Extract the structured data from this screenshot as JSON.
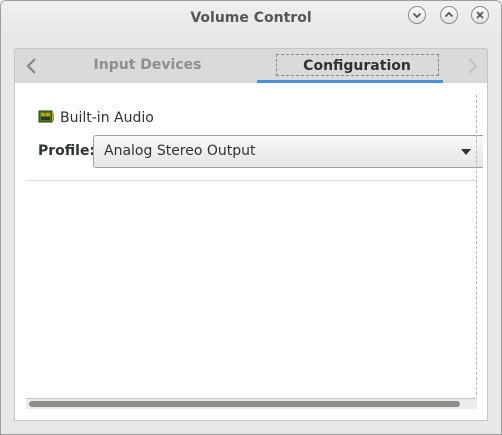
{
  "window": {
    "title": "Volume Control",
    "buttons": [
      "minimize-button",
      "maximize-button",
      "close-button"
    ]
  },
  "tabs": [
    {
      "label": "Input Devices",
      "active": false
    },
    {
      "label": "Configuration",
      "active": true
    }
  ],
  "config": {
    "card_name": "Built-in Audio",
    "profile_label": "Profile:",
    "profile_value": "Analog Stereo Output"
  },
  "colors": {
    "accent": "#4a90d9",
    "background": "#e8e8e7",
    "text": "#2e3436"
  }
}
